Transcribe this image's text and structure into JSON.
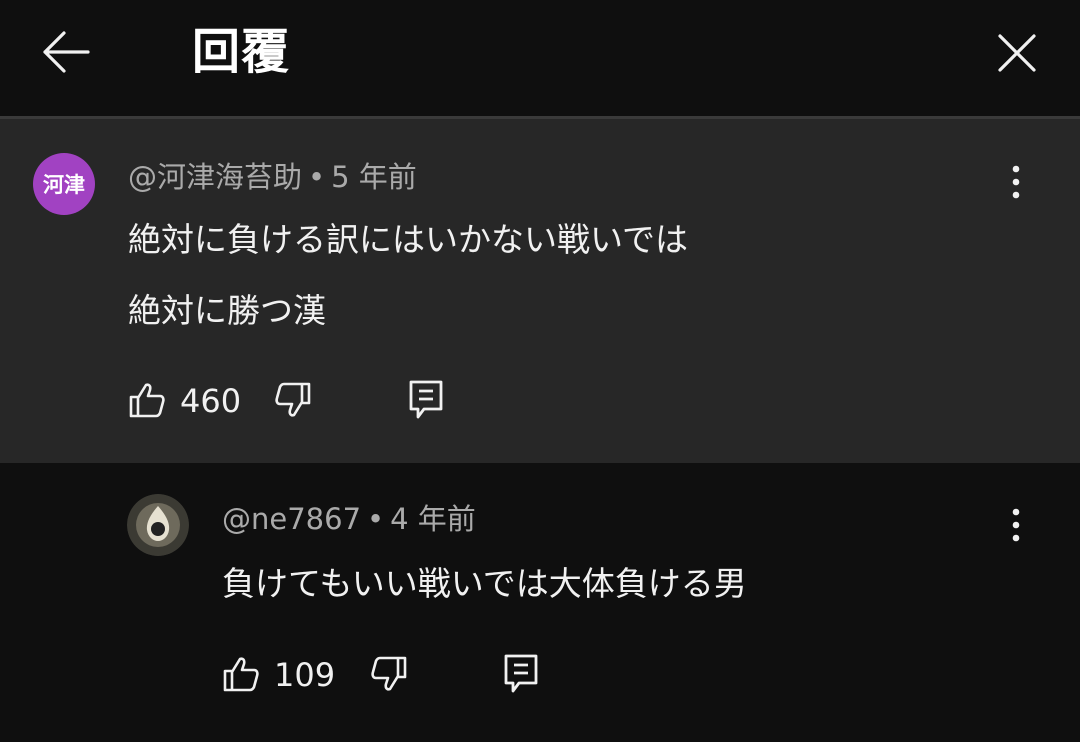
{
  "header": {
    "title": "回覆",
    "back_icon": "arrow-left-icon",
    "close_icon": "close-icon"
  },
  "comment": {
    "avatar_text": "河津",
    "avatar_color": "#a142c2",
    "author": "@河津海苔助",
    "separator": "•",
    "time": "5 年前",
    "lines": [
      "絶対に負ける訳にはいかない戦いでは",
      "絶対に勝つ漢"
    ],
    "likes": "460"
  },
  "reply": {
    "author": "@ne7867",
    "separator": "•",
    "time": "4 年前",
    "text": "負けてもいい戦いでは大体負ける男",
    "likes": "109"
  },
  "colors": {
    "background": "#0f0f0f",
    "highlight": "#272727",
    "meta": "#aaaaaa",
    "text": "#f1f1f1"
  }
}
